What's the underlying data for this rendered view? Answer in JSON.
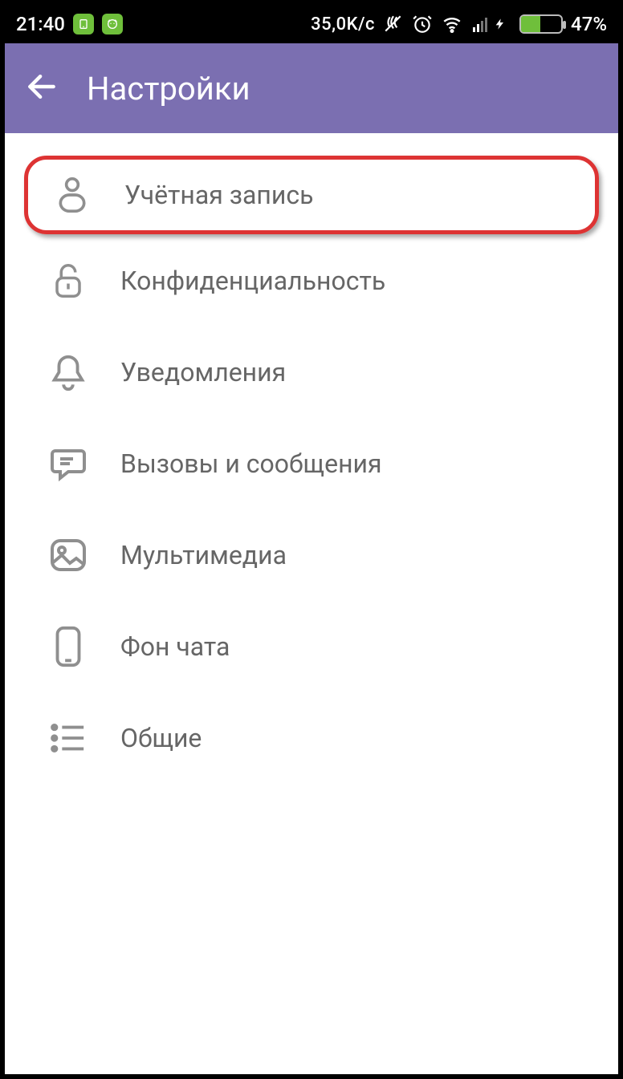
{
  "statusbar": {
    "time": "21:40",
    "network_speed": "35,0K/с",
    "battery_percent": "47%"
  },
  "header": {
    "title": "Настройки"
  },
  "settings": {
    "items": [
      {
        "label": "Учётная запись"
      },
      {
        "label": "Конфиденциальность"
      },
      {
        "label": "Уведомления"
      },
      {
        "label": "Вызовы и сообщения"
      },
      {
        "label": "Мультимедиа"
      },
      {
        "label": "Фон чата"
      },
      {
        "label": "Общие"
      }
    ]
  }
}
